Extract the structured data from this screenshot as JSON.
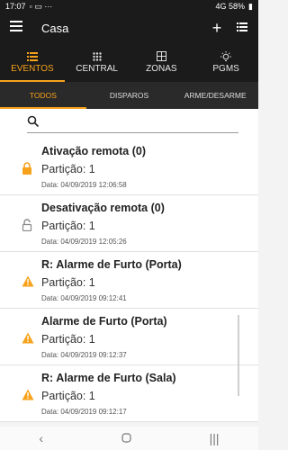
{
  "status": {
    "time": "17:07",
    "right": "4G 58%"
  },
  "appbar": {
    "title": "Casa"
  },
  "topnav": [
    {
      "label": "EVENTOS",
      "icon": "list-icon"
    },
    {
      "label": "CENTRAL",
      "icon": "keypad-icon"
    },
    {
      "label": "ZONAS",
      "icon": "grid-icon"
    },
    {
      "label": "PGMS",
      "icon": "bulb-icon"
    }
  ],
  "subtabs": [
    "TODOS",
    "DISPAROS",
    "ARME/DESARME"
  ],
  "search": {
    "placeholder": ""
  },
  "events": [
    {
      "title": "Ativação remota (0)",
      "partition": "Partição: 1",
      "date": "Data: 04/09/2019 12:06:58",
      "icon": "lock-closed-icon"
    },
    {
      "title": "Desativação remota (0)",
      "partition": "Partição: 1",
      "date": "Data: 04/09/2019 12:05:26",
      "icon": "lock-open-icon"
    },
    {
      "title": "R: Alarme de Furto (Porta)",
      "partition": "Partição: 1",
      "date": "Data: 04/09/2019 09:12:41",
      "icon": "warning-icon"
    },
    {
      "title": "Alarme de Furto (Porta)",
      "partition": "Partição: 1",
      "date": "Data: 04/09/2019 09:12:37",
      "icon": "warning-icon"
    },
    {
      "title": "R: Alarme de Furto (Sala)",
      "partition": "Partição: 1",
      "date": "Data: 04/09/2019 09:12:17",
      "icon": "warning-icon"
    }
  ],
  "colors": {
    "accent": "#f7a21b",
    "bar": "#1b1b1b",
    "subbar": "#2a2a2a"
  }
}
